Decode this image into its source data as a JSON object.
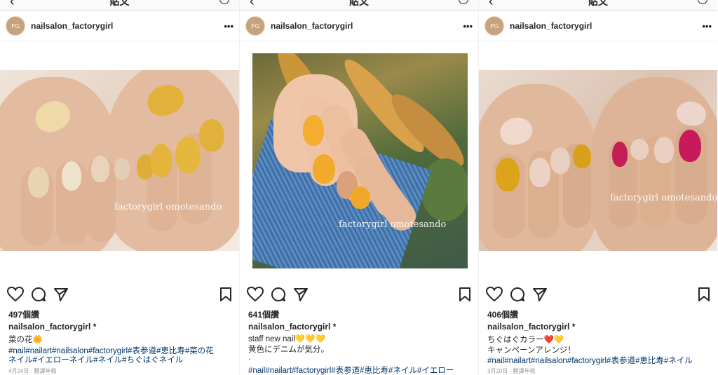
{
  "colors": {
    "text": "#262626",
    "hashtag": "#003569",
    "meta": "#999999",
    "divider": "#efefef"
  },
  "posts": [
    {
      "nav_title": "貼文",
      "username": "nailsalon_factorygirl",
      "avatar_text": "FG",
      "watermark": "factorygirl omotesando",
      "likes": "497個讚",
      "caption_user": "nailsalon_factorygirl *",
      "caption_lines": [
        "菜の花🌼"
      ],
      "hashtag_lines": [
        "#nail#nailart#nailsalon#factorygirl#表参道#恵比寿#菜の花",
        "ネイル#イエローネイル#ネイル#ちぐはぐネイル"
      ],
      "meta": "4月24日 · 翻譯年糕"
    },
    {
      "nav_title": "貼文",
      "username": "nailsalon_factorygirl",
      "avatar_text": "FG",
      "watermark": "factorygirl omotesando",
      "likes": "641個讚",
      "caption_user": "nailsalon_factorygirl *",
      "caption_lines": [
        "staff new nail💛💛💛",
        "黄色にデニムが気分。",
        "."
      ],
      "hashtag_lines": [
        "#nail#nailart#factorygirl#表参道#恵比寿#ネイル#イエロー"
      ],
      "meta": ""
    },
    {
      "nav_title": "貼文",
      "username": "nailsalon_factorygirl",
      "avatar_text": "FG",
      "watermark": "factorygirl omotesando",
      "likes": "406個讚",
      "caption_user": "nailsalon_factorygirl *",
      "caption_lines": [
        "ちぐはぐカラー❤️💛",
        "キャンペーンアレンジ！"
      ],
      "hashtag_lines": [
        "#nail#nailart#nailsalon#factorygirl#表参道#恵比寿#ネイル"
      ],
      "meta": "3月20日 · 翻譯年糕"
    }
  ],
  "icons": {
    "back": "back-arrow-icon",
    "options": "options-circle-icon",
    "more": "more-dots-icon",
    "like": "heart-icon",
    "comment": "comment-icon",
    "share": "share-icon",
    "save": "bookmark-icon"
  }
}
